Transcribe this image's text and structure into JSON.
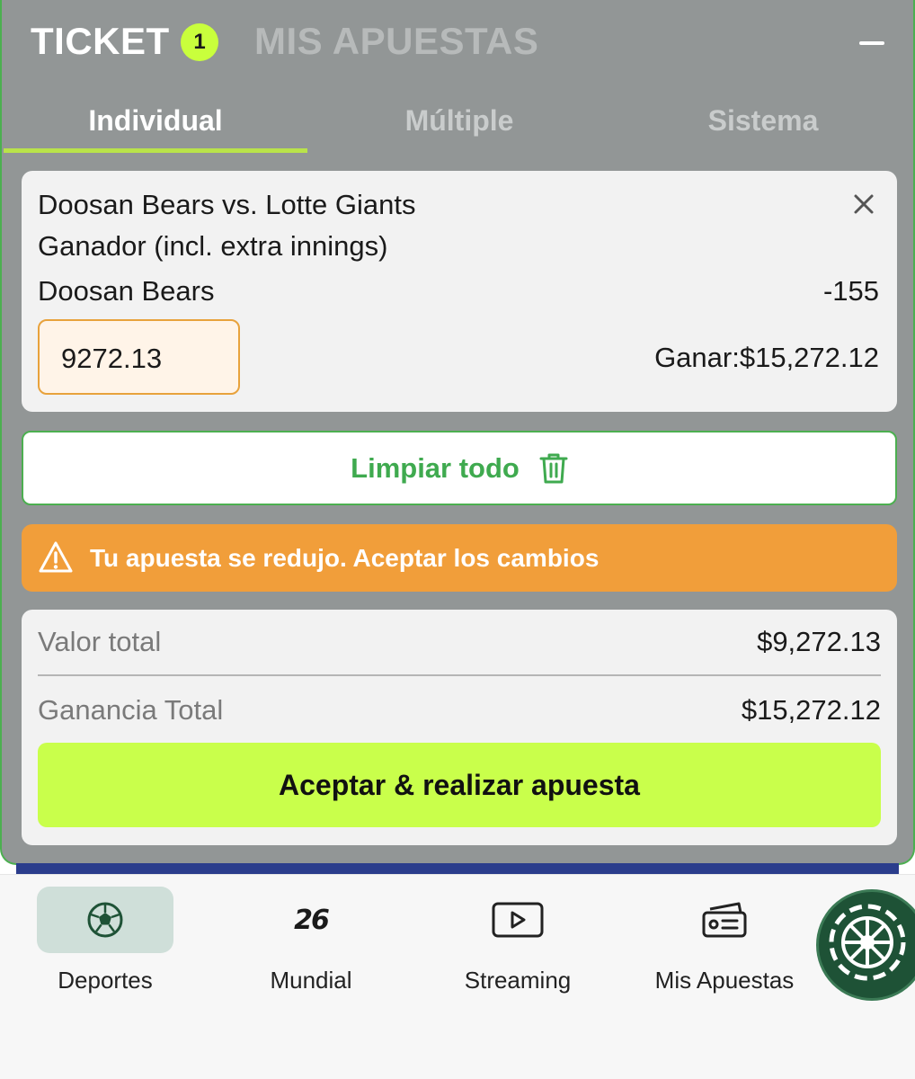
{
  "header": {
    "ticket_label": "TICKET",
    "ticket_count": "1",
    "my_bets_label": "MIS APUESTAS",
    "collapse_icon": "minus-icon"
  },
  "tabs": [
    {
      "label": "Individual",
      "active": true
    },
    {
      "label": "Múltiple",
      "active": false
    },
    {
      "label": "Sistema",
      "active": false
    }
  ],
  "bet": {
    "match": "Doosan Bears vs. Lotte Giants",
    "market": "Ganador (incl. extra innings)",
    "selection": "Doosan Bears",
    "odds": "-155",
    "stake": "9272.13",
    "win_label": "Ganar:",
    "win_value": "$15,272.12",
    "remove_icon": "close-icon"
  },
  "clear_all": {
    "label": "Limpiar todo",
    "icon": "trash-icon"
  },
  "warning": {
    "icon": "warning-triangle-icon",
    "text": "Tu apuesta se redujo. Aceptar los cambios"
  },
  "summary": {
    "total_label": "Valor total",
    "total_value": "$9,272.13",
    "gain_label": "Ganancia Total",
    "gain_value": "$15,272.12",
    "cta_label": "Aceptar & realizar apuesta"
  },
  "bottom_nav": [
    {
      "label": "Deportes",
      "icon": "soccer-ball-icon",
      "active": true
    },
    {
      "label": "Mundial",
      "icon": "mundial-26-icon",
      "icon_text": "26",
      "active": false
    },
    {
      "label": "Streaming",
      "icon": "play-icon",
      "active": false
    },
    {
      "label": "Mis Apuestas",
      "icon": "ticket-icon",
      "active": false
    }
  ],
  "casino_icon": "roulette-icon",
  "colors": {
    "panel_bg": "#929696",
    "accent_green": "#4caf50",
    "lime": "#c9ff4b",
    "warning": "#f19e3a",
    "stake_border": "#e8a23c",
    "nav_active_bg": "#cfdfd9",
    "roulette_bg": "#1e5236"
  }
}
